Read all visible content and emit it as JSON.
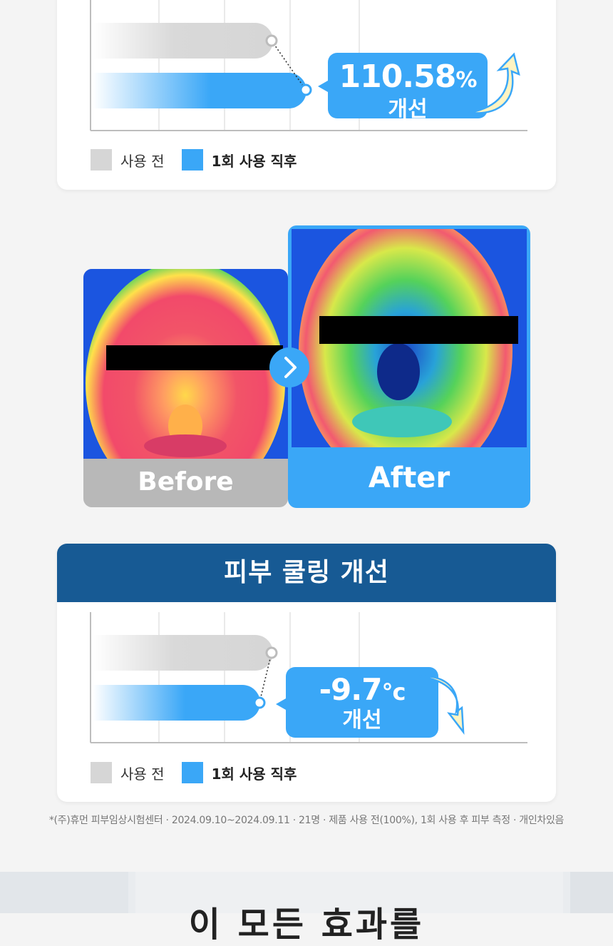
{
  "top_card": {
    "legend": {
      "before": "사용 전",
      "after": "1회 사용 직후"
    },
    "callout": {
      "value": "110.58",
      "unit": "%",
      "label": "개선"
    }
  },
  "comparison": {
    "before_label": "Before",
    "after_label": "After"
  },
  "bottom_card": {
    "title": "피부 쿨링 개선",
    "legend": {
      "before": "사용 전",
      "after": "1회 사용 직후"
    },
    "callout": {
      "value": "-9.7",
      "unit": "°c",
      "label": "개선"
    }
  },
  "footnote": "*(주)휴먼 피부임상시험센터 · 2024.09.10~2024.09.11 · 21명 · 제품 사용 전(100%), 1회 사용 후 피부 측정 · 개인차있음",
  "next_section_title": "이 모든 효과를",
  "colors": {
    "before_bar": "#d6d6d6",
    "after_bar": "#3aa7f7",
    "header": "#175a94",
    "arrow": "#fff4c2"
  }
}
